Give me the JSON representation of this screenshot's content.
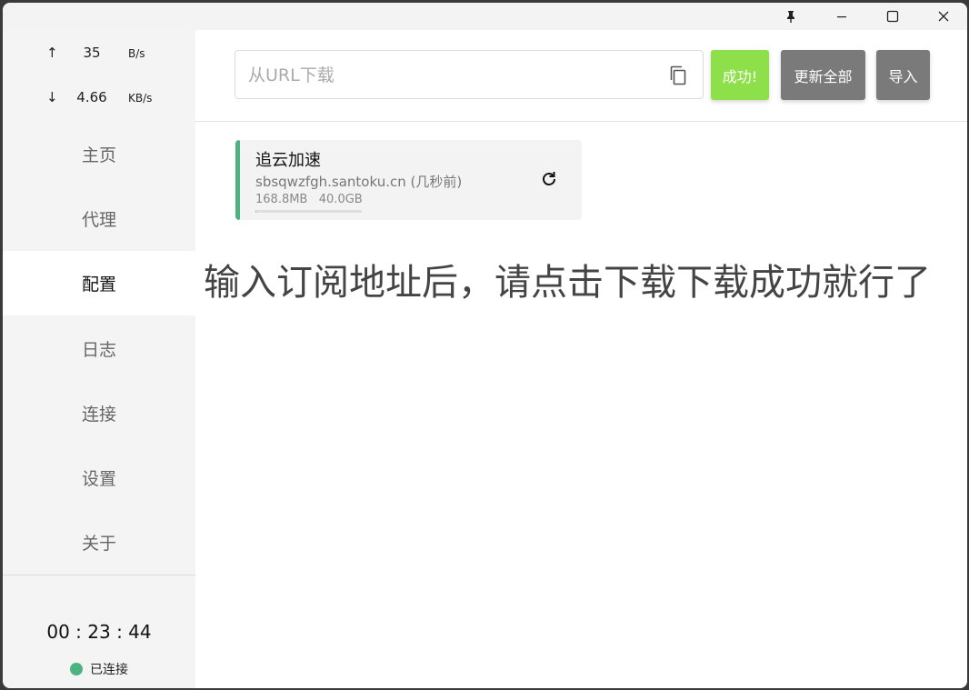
{
  "speed": {
    "up_arrow": "↑",
    "up_value": "35",
    "up_unit": "B/s",
    "down_arrow": "↓",
    "down_value": "4.66",
    "down_unit": "KB/s"
  },
  "nav": {
    "home": "主页",
    "proxy": "代理",
    "profiles": "配置",
    "logs": "日志",
    "connections": "连接",
    "settings": "设置",
    "about": "关于"
  },
  "uptime": "00 : 23 : 44",
  "status_text": "已连接",
  "toolbar": {
    "url_placeholder": "从URL下载",
    "success_label": "成功!",
    "update_all_label": "更新全部",
    "import_label": "导入"
  },
  "profile": {
    "name": "追云加速",
    "url": "sbsqwzfgh.santoku.cn",
    "updated": "(几秒前)",
    "used": "168.8MB",
    "total": "40.0GB",
    "usage_fraction": 0.004
  },
  "annotation": "输入订阅地址后，请点击下载下载成功就行了",
  "colors": {
    "accent": "#4db380",
    "success_button": "#8ee04a",
    "gray_button": "#7a7a7a"
  },
  "icons": [
    "pin-icon",
    "minimize-icon",
    "maximize-icon",
    "close-icon",
    "copy-icon",
    "refresh-icon"
  ]
}
